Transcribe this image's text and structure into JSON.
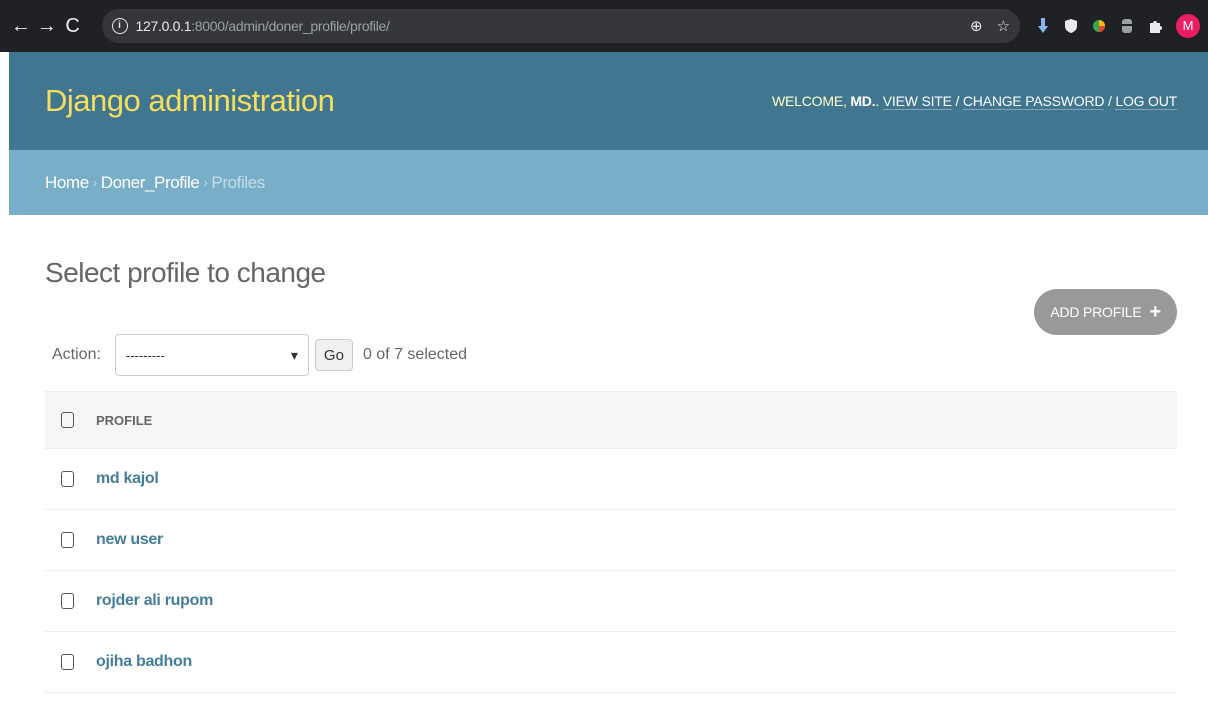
{
  "browser": {
    "url_host": "127.0.0.1",
    "url_path": ":8000/admin/doner_profile/profile/",
    "back_icon": "←",
    "forward_icon": "→",
    "reload_icon": "C",
    "zoom_icon": "⊕",
    "star_icon": "☆",
    "avatar_letter": "M"
  },
  "header": {
    "branding": "Django administration",
    "welcome": "WELCOME, ",
    "username": "MD.",
    "welcome_after": ". ",
    "view_site": "VIEW SITE",
    "slash1": " / ",
    "change_password": "CHANGE PASSWORD",
    "slash2": " / ",
    "log_out": "LOG OUT"
  },
  "breadcrumbs": {
    "home": "Home",
    "separator": "›",
    "app": "Doner_Profile",
    "current": "Profiles"
  },
  "content": {
    "title": "Select profile to change",
    "add_button": "ADD PROFILE"
  },
  "actions": {
    "label": "Action:",
    "selected": "---------",
    "go": "Go",
    "counter": "0 of 7 selected"
  },
  "table": {
    "header": "PROFILE",
    "rows": [
      "md kajol",
      "new user",
      "rojder ali rupom",
      "ojiha badhon"
    ]
  },
  "colors": {
    "header_bg": "#417690",
    "breadcrumbs_bg": "#79aec8",
    "branding": "#f5dd5d",
    "link": "#447e9b"
  }
}
